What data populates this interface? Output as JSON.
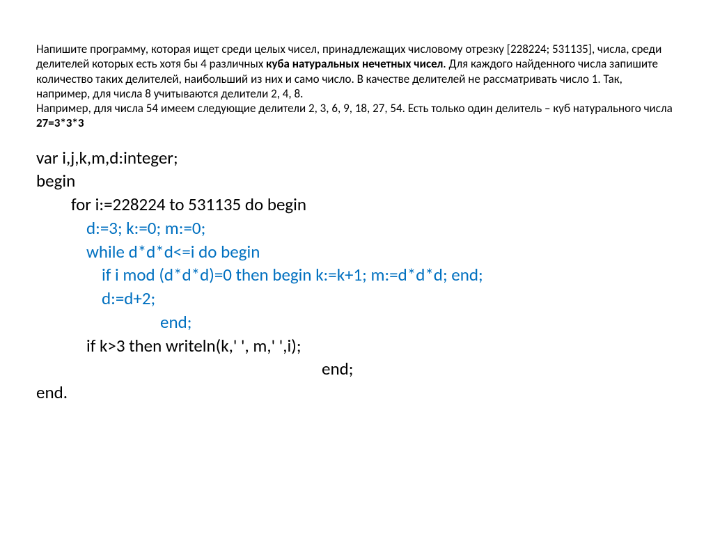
{
  "problem": {
    "p1a": "Напишите программу, которая ищет среди целых чисел, принадлежащих числовому отрезку [228224; 531135], числа, среди делителей которых есть хотя бы 4 различных ",
    "p1b": "куба натуральных нечетных чисел",
    "p1c": ". Для каждого найденного числа запишите количество таких делителей, наибольший из них и само число. В качестве делителей не рассматривать число 1. Так, например, для числа 8 учитываются делители 2, 4, 8.",
    "p2a": "Например, для числа 54 имеем следующие делители 2, 3, 6, 9, 18, 27, 54.  Есть только один делитель – куб натурального числа  ",
    "p2b": "27=3*3*3"
  },
  "code": {
    "l1": "var i,j,k,m,d:integer;",
    "l2": "begin",
    "l3": "for i:=228224 to 531135 do begin",
    "l4": "d:=3; k:=0; m:=0;",
    "l5": "while d*d*d<=i do begin",
    "l6": "if i mod (d*d*d)=0 then begin k:=k+1; m:=d*d*d; end;",
    "l7": "d:=d+2;",
    "l8": "end;",
    "l9": "if k>3 then writeln(k,' ', m,' ',i);",
    "l10": "end;",
    "l11": "end."
  }
}
